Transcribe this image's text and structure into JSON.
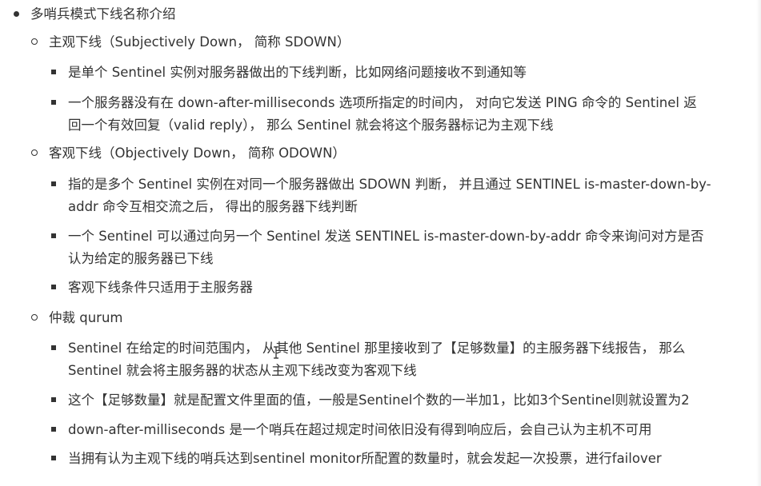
{
  "level1": {
    "label": "多哨兵模式下线名称介绍"
  },
  "sections": [
    {
      "title": "主观下线（Subjectively Down， 简称 SDOWN）",
      "items": [
        [
          "是单个 Sentinel 实例对服务器做出的下线判断，比如网络问题接收不到通知等"
        ],
        [
          "一个服务器没有在 down-after-milliseconds 选项所指定的时间内， 对向它发送 PING 命令的 Sentinel 返",
          "回一个有效回复（valid reply）， 那么 Sentinel 就会将这个服务器标记为主观下线"
        ]
      ]
    },
    {
      "title": "客观下线（Objectively Down， 简称 ODOWN）",
      "items": [
        [
          "指的是多个 Sentinel 实例在对同一个服务器做出 SDOWN 判断， 并且通过 SENTINEL is-master-down-by-",
          "addr 命令互相交流之后， 得出的服务器下线判断"
        ],
        [
          "一个 Sentinel 可以通过向另一个 Sentinel 发送 SENTINEL is-master-down-by-addr 命令来询问对方是否",
          "认为给定的服务器已下线"
        ],
        [
          "客观下线条件只适用于主服务器"
        ]
      ]
    },
    {
      "title": "仲裁 qurum",
      "items": [
        [
          " Sentinel 在给定的时间范围内， 从其他 Sentinel 那里接收到了【足够数量】的主服务器下线报告， 那么",
          "Sentinel 就会将主服务器的状态从主观下线改变为客观下线"
        ],
        [
          "这个【足够数量】就是配置文件里面的值，一般是Sentinel个数的一半加1，比如3个Sentinel则就设置为2"
        ],
        [
          "down-after-milliseconds  是一个哨兵在超过规定时间依旧没有得到响应后，会自己认为主机不可用"
        ],
        [
          "当拥有认为主观下线的哨兵达到sentinel monitor所配置的数量时，就会发起一次投票，进行failover"
        ]
      ]
    }
  ]
}
